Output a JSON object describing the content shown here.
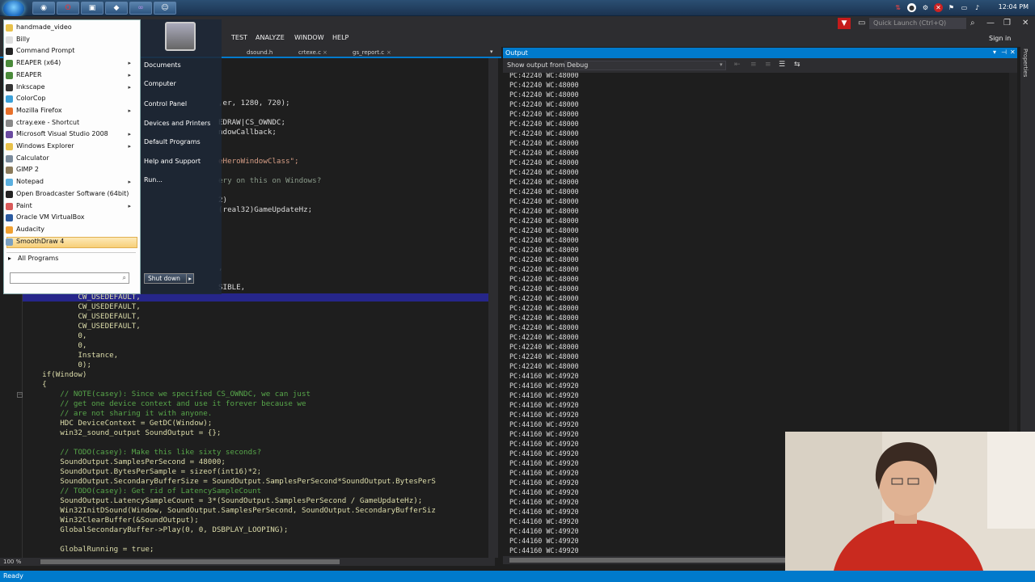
{
  "taskbar": {
    "clock": "12:04 PM",
    "buttons": [
      "chrome",
      "opera",
      "cmd",
      "vs",
      "vs-icon",
      "gimp"
    ]
  },
  "vs": {
    "menu": [
      "TEST",
      "ANALYZE",
      "WINDOW",
      "HELP"
    ],
    "quick_launch_placeholder": "Quick Launch (Ctrl+Q)",
    "sign_in": "Sign in",
    "tabs": [
      "dsound.h",
      "crtexe.c",
      "gs_report.c"
    ],
    "tab_pins": [
      "×",
      "×"
    ],
    "zoom": "100 %",
    "status": "Ready",
    "properties_label": "Properties",
    "code_fragments": [
      ",er, 1280, 720);",
      "EDRAW|CS_OWNDC;",
      "ndowCallback;",
      "eHeroWindowClass\";",
      "ery on this on Windows?",
      "2)",
      "(real32)GameUpdateHz;",
      ",",
      "SIBLE,"
    ],
    "code_lines": [
      "            CW_USEDEFAULT,",
      "            CW_USEDEFAULT,",
      "            CW_USEDEFAULT,",
      "            CW_USEDEFAULT,",
      "            0,",
      "            0,",
      "            Instance,",
      "            0);",
      "    if(Window)",
      "    {",
      "        // NOTE(casey): Since we specified CS_OWNDC, we can just",
      "        // get one device context and use it forever because we",
      "        // are not sharing it with anyone.",
      "        HDC DeviceContext = GetDC(Window);",
      "        win32_sound_output SoundOutput = {};",
      "",
      "        // TODO(casey): Make this like sixty seconds?",
      "        SoundOutput.SamplesPerSecond = 48000;",
      "        SoundOutput.BytesPerSample = sizeof(int16)*2;",
      "        SoundOutput.SecondaryBufferSize = SoundOutput.SamplesPerSecond*SoundOutput.BytesPerS",
      "        // TODO(casey): Get rid of LatencySampleCount",
      "        SoundOutput.LatencySampleCount = 3*(SoundOutput.SamplesPerSecond / GameUpdateHz);",
      "        Win32InitDSound(Window, SoundOutput.SamplesPerSecond, SoundOutput.SecondaryBufferSiz",
      "        Win32ClearBuffer(&SoundOutput);",
      "        GlobalSecondaryBuffer->Play(0, 0, DSBPLAY_LOOPING);",
      "",
      "        GlobalRunning = true;"
    ]
  },
  "output": {
    "title": "Output",
    "show_output_from": "Show output from:",
    "source": "Debug",
    "lines_a": "PC:42240 WC:48000",
    "count_a": 31,
    "lines_b": "PC:44160 WC:49920",
    "count_b": 19
  },
  "start_menu": {
    "programs": [
      {
        "label": "handmade_video",
        "color": "#e8c14a",
        "arrow": false
      },
      {
        "label": "Billy",
        "color": "#dddddd",
        "arrow": false
      },
      {
        "label": "Command Prompt",
        "color": "#222222",
        "arrow": false
      },
      {
        "label": "REAPER (x64)",
        "color": "#4a8a3a",
        "arrow": true
      },
      {
        "label": "REAPER",
        "color": "#4a8a3a",
        "arrow": true
      },
      {
        "label": "Inkscape",
        "color": "#333333",
        "arrow": true
      },
      {
        "label": "ColorCop",
        "color": "#3aa0d8",
        "arrow": false
      },
      {
        "label": "Mozilla Firefox",
        "color": "#e8702a",
        "arrow": true
      },
      {
        "label": "ctray.exe - Shortcut",
        "color": "#888888",
        "arrow": false
      },
      {
        "label": "Microsoft Visual Studio 2008",
        "color": "#6a4aa0",
        "arrow": true
      },
      {
        "label": "Windows Explorer",
        "color": "#e8c14a",
        "arrow": true
      },
      {
        "label": "Calculator",
        "color": "#7a8a9a",
        "arrow": false
      },
      {
        "label": "GIMP 2",
        "color": "#8a7a5a",
        "arrow": false
      },
      {
        "label": "Notepad",
        "color": "#5ab0e0",
        "arrow": true
      },
      {
        "label": "Open Broadcaster Software (64bit)",
        "color": "#222222",
        "arrow": false
      },
      {
        "label": "Paint",
        "color": "#d85a5a",
        "arrow": true
      },
      {
        "label": "Oracle VM VirtualBox",
        "color": "#2a5aa0",
        "arrow": false
      },
      {
        "label": "Audacity",
        "color": "#f0a030",
        "arrow": false
      },
      {
        "label": "SmoothDraw 4",
        "color": "#7aa0c0",
        "arrow": false
      }
    ],
    "all_programs": "All Programs",
    "right_items": [
      "Documents",
      "Computer",
      "Control Panel",
      "Devices and Printers",
      "Default Programs",
      "Help and Support",
      "Run..."
    ],
    "search_placeholder": "",
    "shutdown": "Shut down"
  }
}
